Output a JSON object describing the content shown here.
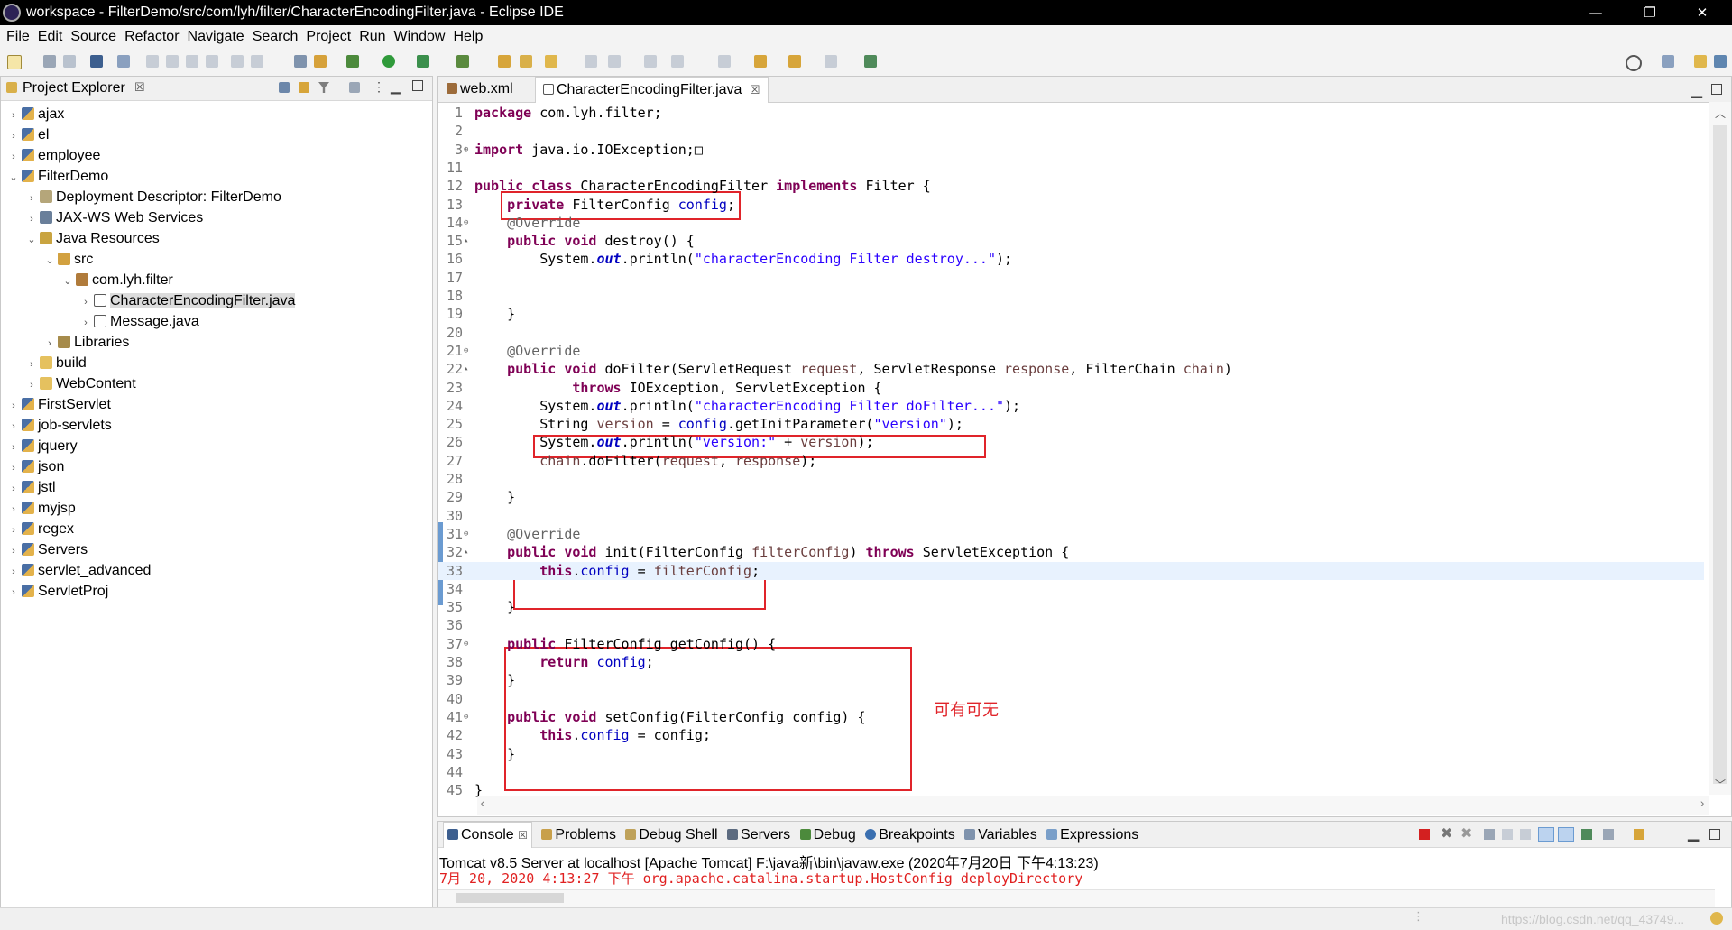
{
  "window": {
    "title": "workspace - FilterDemo/src/com/lyh/filter/CharacterEncodingFilter.java - Eclipse IDE",
    "minimize": "—",
    "restore": "❐",
    "close": "✕"
  },
  "menu": [
    "File",
    "Edit",
    "Source",
    "Refactor",
    "Navigate",
    "Search",
    "Project",
    "Run",
    "Window",
    "Help"
  ],
  "explorer": {
    "title": "Project Explorer",
    "close": "☒",
    "items": [
      {
        "label": "ajax",
        "arrow": "›",
        "icon": "project-icon"
      },
      {
        "label": "el",
        "arrow": "›",
        "icon": "project-icon"
      },
      {
        "label": "employee",
        "arrow": "›",
        "icon": "project-icon"
      },
      {
        "label": "FilterDemo",
        "arrow": "⌄",
        "icon": "project-icon"
      },
      {
        "label": "Deployment Descriptor: FilterDemo",
        "arrow": "›",
        "icon": "deployment-descriptor-icon"
      },
      {
        "label": "JAX-WS Web Services",
        "arrow": "›",
        "icon": "web-services-icon"
      },
      {
        "label": "Java Resources",
        "arrow": "⌄",
        "icon": "java-resources-icon"
      },
      {
        "label": "src",
        "arrow": "⌄",
        "icon": "source-folder-icon"
      },
      {
        "label": "com.lyh.filter",
        "arrow": "⌄",
        "icon": "package-icon"
      },
      {
        "label": "CharacterEncodingFilter.java",
        "arrow": "›",
        "icon": "java-file-icon"
      },
      {
        "label": "Message.java",
        "arrow": "›",
        "icon": "java-file-icon"
      },
      {
        "label": "Libraries",
        "arrow": "›",
        "icon": "libraries-icon"
      },
      {
        "label": "build",
        "arrow": "›",
        "icon": "folder-icon"
      },
      {
        "label": "WebContent",
        "arrow": "›",
        "icon": "folder-icon"
      },
      {
        "label": "FirstServlet",
        "arrow": "›",
        "icon": "project-icon"
      },
      {
        "label": "job-servlets",
        "arrow": "›",
        "icon": "project-icon"
      },
      {
        "label": "jquery",
        "arrow": "›",
        "icon": "project-icon"
      },
      {
        "label": "json",
        "arrow": "›",
        "icon": "project-icon"
      },
      {
        "label": "jstl",
        "arrow": "›",
        "icon": "project-icon"
      },
      {
        "label": "myjsp",
        "arrow": "›",
        "icon": "project-icon"
      },
      {
        "label": "regex",
        "arrow": "›",
        "icon": "project-icon"
      },
      {
        "label": "Servers",
        "arrow": "›",
        "icon": "project-icon"
      },
      {
        "label": "servlet_advanced",
        "arrow": "›",
        "icon": "project-icon"
      },
      {
        "label": "ServletProj",
        "arrow": "›",
        "icon": "project-icon"
      }
    ]
  },
  "editor": {
    "tabs": [
      {
        "label": "web.xml"
      },
      {
        "label": "CharacterEncodingFilter.java",
        "close": "☒"
      }
    ],
    "lines": [
      {
        "n": "1",
        "code": "package com.lyh.filter;"
      },
      {
        "n": "2",
        "code": ""
      },
      {
        "n": "3",
        "code": "import java.io.IOException;□"
      },
      {
        "n": "11",
        "code": ""
      },
      {
        "n": "12",
        "code": "public class CharacterEncodingFilter implements Filter {"
      },
      {
        "n": "13",
        "code": "    private FilterConfig config;"
      },
      {
        "n": "14",
        "code": "    @Override"
      },
      {
        "n": "15",
        "code": "    public void destroy() {"
      },
      {
        "n": "16",
        "code": "        System.out.println(\"characterEncoding Filter destroy...\");"
      },
      {
        "n": "17",
        "code": ""
      },
      {
        "n": "18",
        "code": ""
      },
      {
        "n": "19",
        "code": "    }"
      },
      {
        "n": "20",
        "code": ""
      },
      {
        "n": "21",
        "code": "    @Override"
      },
      {
        "n": "22",
        "code": "    public void doFilter(ServletRequest request, ServletResponse response, FilterChain chain)"
      },
      {
        "n": "23",
        "code": "            throws IOException, ServletException {"
      },
      {
        "n": "24",
        "code": "        System.out.println(\"characterEncoding Filter doFilter...\");"
      },
      {
        "n": "25",
        "code": "        String version = config.getInitParameter(\"version\");"
      },
      {
        "n": "26",
        "code": "        System.out.println(\"version:\" + version);"
      },
      {
        "n": "27",
        "code": "        chain.doFilter(request, response);"
      },
      {
        "n": "28",
        "code": ""
      },
      {
        "n": "29",
        "code": "    }"
      },
      {
        "n": "30",
        "code": ""
      },
      {
        "n": "31",
        "code": "    @Override"
      },
      {
        "n": "32",
        "code": "    public void init(FilterConfig filterConfig) throws ServletException {"
      },
      {
        "n": "33",
        "code": "        this.config = filterConfig;"
      },
      {
        "n": "34",
        "code": ""
      },
      {
        "n": "35",
        "code": "    }"
      },
      {
        "n": "36",
        "code": ""
      },
      {
        "n": "37",
        "code": "    public FilterConfig getConfig() {"
      },
      {
        "n": "38",
        "code": "        return config;"
      },
      {
        "n": "39",
        "code": "    }"
      },
      {
        "n": "40",
        "code": ""
      },
      {
        "n": "41",
        "code": "    public void setConfig(FilterConfig config) {"
      },
      {
        "n": "42",
        "code": "        this.config = config;"
      },
      {
        "n": "43",
        "code": "    }"
      },
      {
        "n": "44",
        "code": ""
      },
      {
        "n": "45",
        "code": "}"
      }
    ],
    "annotation_note": "可有可无"
  },
  "console": {
    "tabs": [
      "Console",
      "Problems",
      "Debug Shell",
      "Servers",
      "Debug",
      "Breakpoints",
      "Variables",
      "Expressions"
    ],
    "header": "Tomcat v8.5 Server at localhost [Apache Tomcat] F:\\java新\\bin\\javaw.exe  (2020年7月20日 下午4:13:23)",
    "log": "7月 20, 2020 4:13:27 下午 org.apache.catalina.startup.HostConfig deployDirectory"
  },
  "status": {
    "watermark": "https://blog.csdn.net/qq_43749..."
  },
  "colors": {
    "keyword": "#7f0055",
    "field": "#0000c0",
    "string": "#2a00ff",
    "annotation_box": "#e0242a"
  }
}
